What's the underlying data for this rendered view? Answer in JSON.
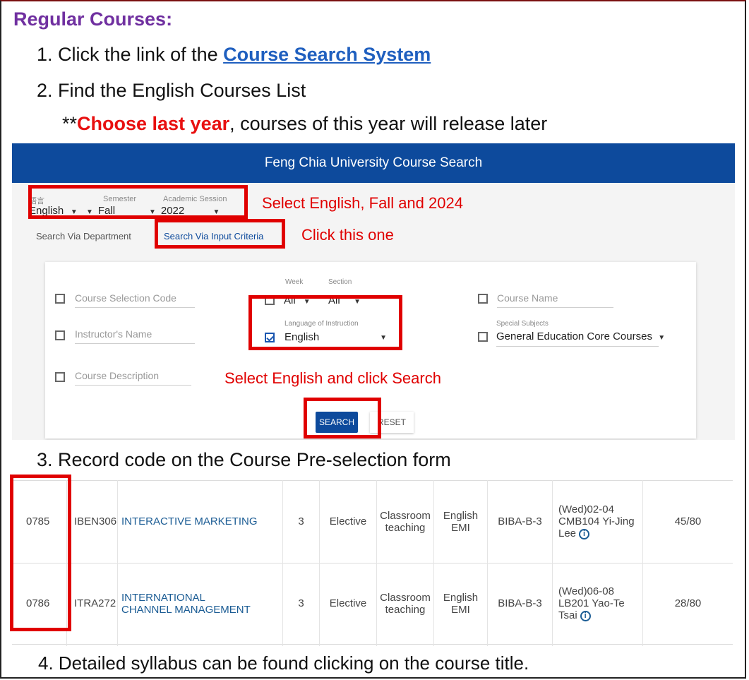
{
  "heading": "Regular Courses:",
  "steps": {
    "s1_prefix": "1. Click the link of the ",
    "s1_link": "Course Search System",
    "s2": "2. Find the English Courses List",
    "note_prefix": "**",
    "note_strong": "Choose last year",
    "note_rest": ", courses of this year will release later",
    "s3": "3. Record code on the Course Pre-selection form",
    "s4": "4. Detailed syllabus can be found clicking on the course title."
  },
  "search_page": {
    "title": "Feng Chia University Course Search",
    "language_label": "語言",
    "language_value": "English",
    "semester_label": "Semester",
    "semester_value": "Fall",
    "session_label": "Academic Session",
    "session_value": "2022",
    "tab_department": "Search Via Department",
    "tab_input": "Search Via Input Criteria",
    "fields": {
      "course_code": "Course Selection Code",
      "week_label": "Week",
      "week_value": "All",
      "section_label": "Section",
      "section_value": "All",
      "course_name": "Course Name",
      "instructor": "Instructor's Name",
      "lang_instr_label": "Language of Instruction",
      "lang_instr_value": "English",
      "special_label": "Special Subjects",
      "special_value": "General Education Core Courses",
      "description": "Course Description"
    },
    "search_button": "SEARCH",
    "reset_button": "RESET"
  },
  "annotations": {
    "a1": "Select English, Fall and 2024",
    "a2": "Click this one",
    "a3": "Select English and click Search"
  },
  "courses": [
    {
      "code": "0785",
      "course_id": "IBEN306",
      "title_line1": "INTERACTIVE MARKETING",
      "title_line2": "",
      "credits": "3",
      "type": "Elective",
      "mode_line1": "Classroom",
      "mode_line2": "teaching",
      "lang_line1": "English",
      "lang_line2": "EMI",
      "class": "BIBA-B-3",
      "time_line1": "(Wed)02-04",
      "time_line2": "CMB104 Yi-Jing",
      "time_line3": "Lee",
      "seats": "45/80"
    },
    {
      "code": "0786",
      "course_id": "ITRA272",
      "title_line1": "INTERNATIONAL",
      "title_line2": "CHANNEL MANAGEMENT",
      "credits": "3",
      "type": "Elective",
      "mode_line1": "Classroom",
      "mode_line2": "teaching",
      "lang_line1": "English",
      "lang_line2": "EMI",
      "class": "BIBA-B-3",
      "time_line1": "(Wed)06-08",
      "time_line2": "LB201 Yao-Te",
      "time_line3": "Tsai",
      "seats": "28/80"
    }
  ],
  "colors": {
    "heading": "#7030a0",
    "link": "#1f5fbf",
    "highlight": "#e81010",
    "annotation": "#e00000",
    "topbar": "#0d4a9c"
  }
}
